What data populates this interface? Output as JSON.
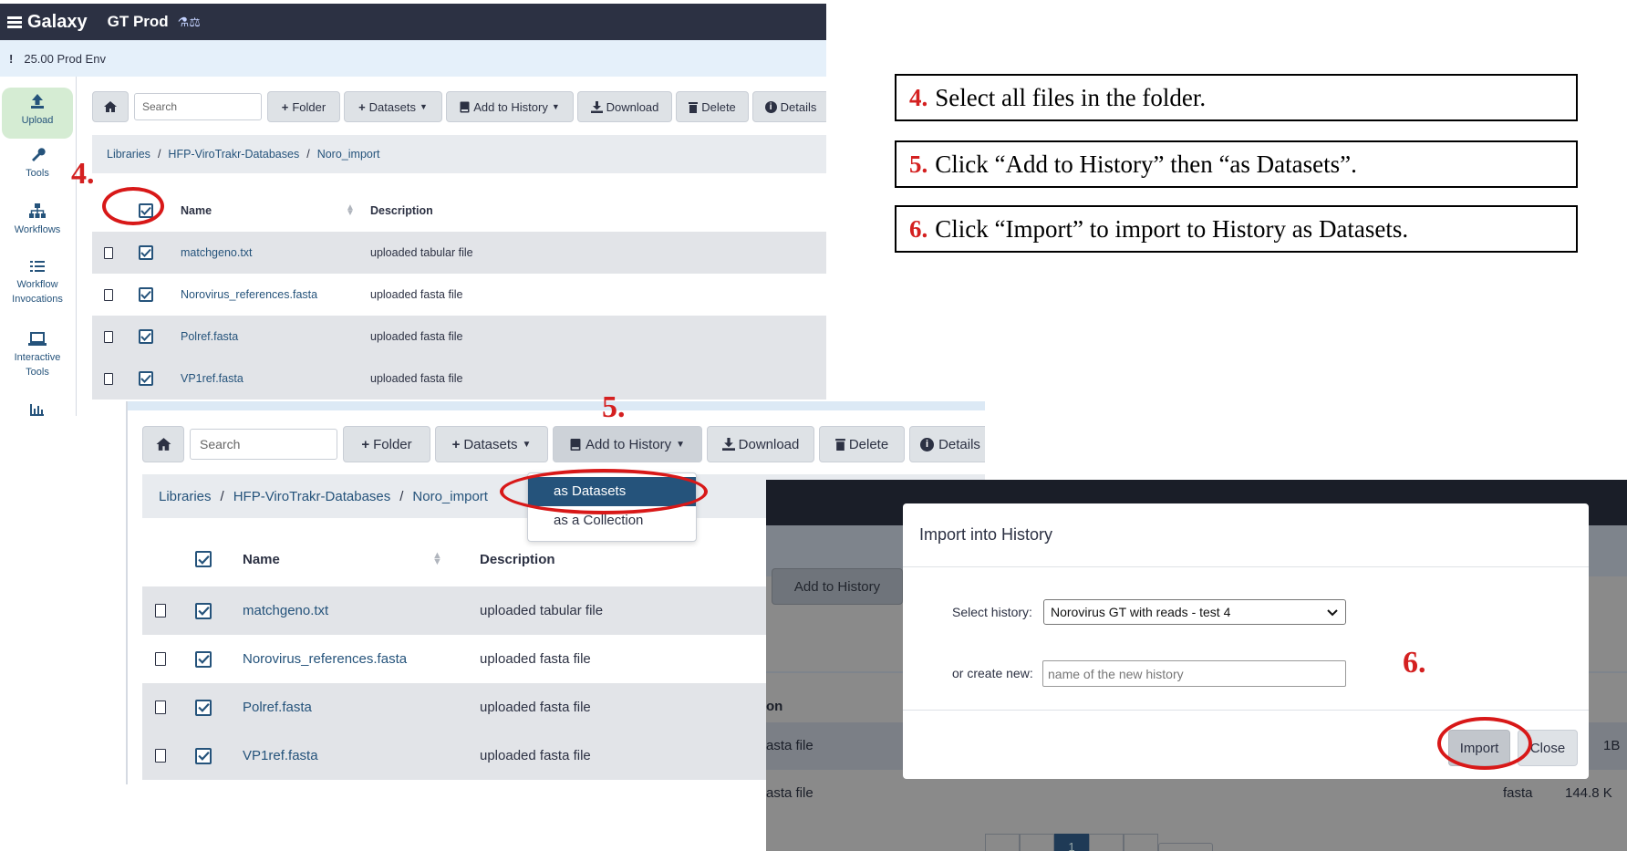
{
  "app": {
    "brand": "Galaxy",
    "instance": "GT Prod",
    "instance_icons": "⚗⚖",
    "banner": "25.00 Prod Env",
    "banner_bang": "!"
  },
  "sidebar": {
    "items": [
      {
        "label": "Upload",
        "icon": "upload-icon"
      },
      {
        "label": "Tools",
        "icon": "wrench-icon"
      },
      {
        "label": "Workflows",
        "icon": "sitemap-icon"
      },
      {
        "label": "Workflow",
        "label2": "Invocations",
        "icon": "list-icon"
      },
      {
        "label": "Interactive",
        "label2": "Tools",
        "icon": "laptop-icon"
      },
      {
        "icon": "chart-icon"
      }
    ]
  },
  "toolbar": {
    "search_placeholder": "Search",
    "folder": "Folder",
    "datasets": "Datasets",
    "add_to_history": "Add to History",
    "download": "Download",
    "delete": "Delete",
    "details": "Details"
  },
  "breadcrumb": {
    "root": "Libraries",
    "library": "HFP-ViroTrakr-Databases",
    "folder": "Noro_import",
    "sep": "/"
  },
  "table": {
    "col_name": "Name",
    "col_desc": "Description",
    "rows": [
      {
        "name": "matchgeno.txt",
        "desc": "uploaded tabular file"
      },
      {
        "name": "Norovirus_references.fasta",
        "desc": "uploaded fasta file"
      },
      {
        "name": "Polref.fasta",
        "desc": "uploaded fasta file"
      },
      {
        "name": "VP1ref.fasta",
        "desc": "uploaded fasta file"
      }
    ]
  },
  "dropdown": {
    "as_datasets": "as Datasets",
    "as_collection": "as a Collection"
  },
  "modal": {
    "title": "Import into History",
    "select_label": "Select history:",
    "select_value": "Norovirus GT with reads - test 4",
    "create_label": "or create new:",
    "create_placeholder": "name of the new history",
    "import": "Import",
    "close": "Close"
  },
  "modal_bg": {
    "add_to_history": "Add to History",
    "col_partial": "on",
    "row1": "asta file",
    "row2": "asta file",
    "row2_type": "fasta",
    "row2_size": "144.8 K",
    "row1_size": "1B",
    "page": "1"
  },
  "steps": {
    "s4": "4.",
    "s5": "5.",
    "s6": "6."
  },
  "instructions": [
    {
      "num": "4.",
      "text": "Select all files in the folder."
    },
    {
      "num": "5.",
      "text": "Click “Add to History” then “as Datasets”."
    },
    {
      "num": "6.",
      "text": "Click “Import” to import to History as Datasets."
    }
  ],
  "colors": {
    "masthead": "#2c3143",
    "link": "#25537b",
    "annotation_red": "#d81818",
    "active_sidebar": "#d5ecd3"
  }
}
